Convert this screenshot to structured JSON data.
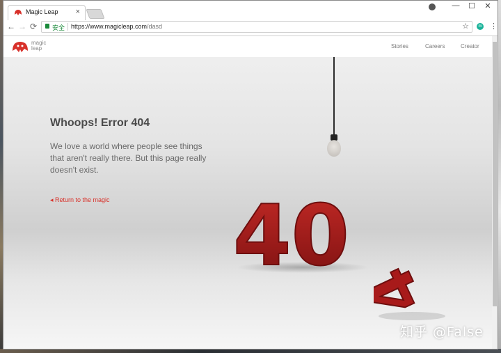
{
  "browser": {
    "tab_title": "Magic Leap",
    "tab_close": "×",
    "minimize": "—",
    "maximize": "☐",
    "close": "✕",
    "back": "←",
    "forward": "→",
    "reload": "⟳",
    "secure_label": "安全",
    "url_base": "https://www.magicleap.com",
    "url_path": "/dasd",
    "bookmark": "☆",
    "menu": "⋮",
    "extension_label": "m"
  },
  "site": {
    "logo_line1": "magic",
    "logo_line2": "leap",
    "nav": [
      "Stories",
      "Careers",
      "Creator"
    ]
  },
  "error": {
    "headline": "Whoops! Error 404",
    "body": "We love a world where people see things that aren't really there. But this page really doesn't exist.",
    "return_link": "◂ Return to the magic",
    "graphic_text": "40",
    "fallen_digit": "4"
  },
  "watermark": "知乎 @False",
  "colors": {
    "accent_red": "#d8312a",
    "digit_red": "#a81a1a",
    "secure_green": "#1a8a3a"
  }
}
